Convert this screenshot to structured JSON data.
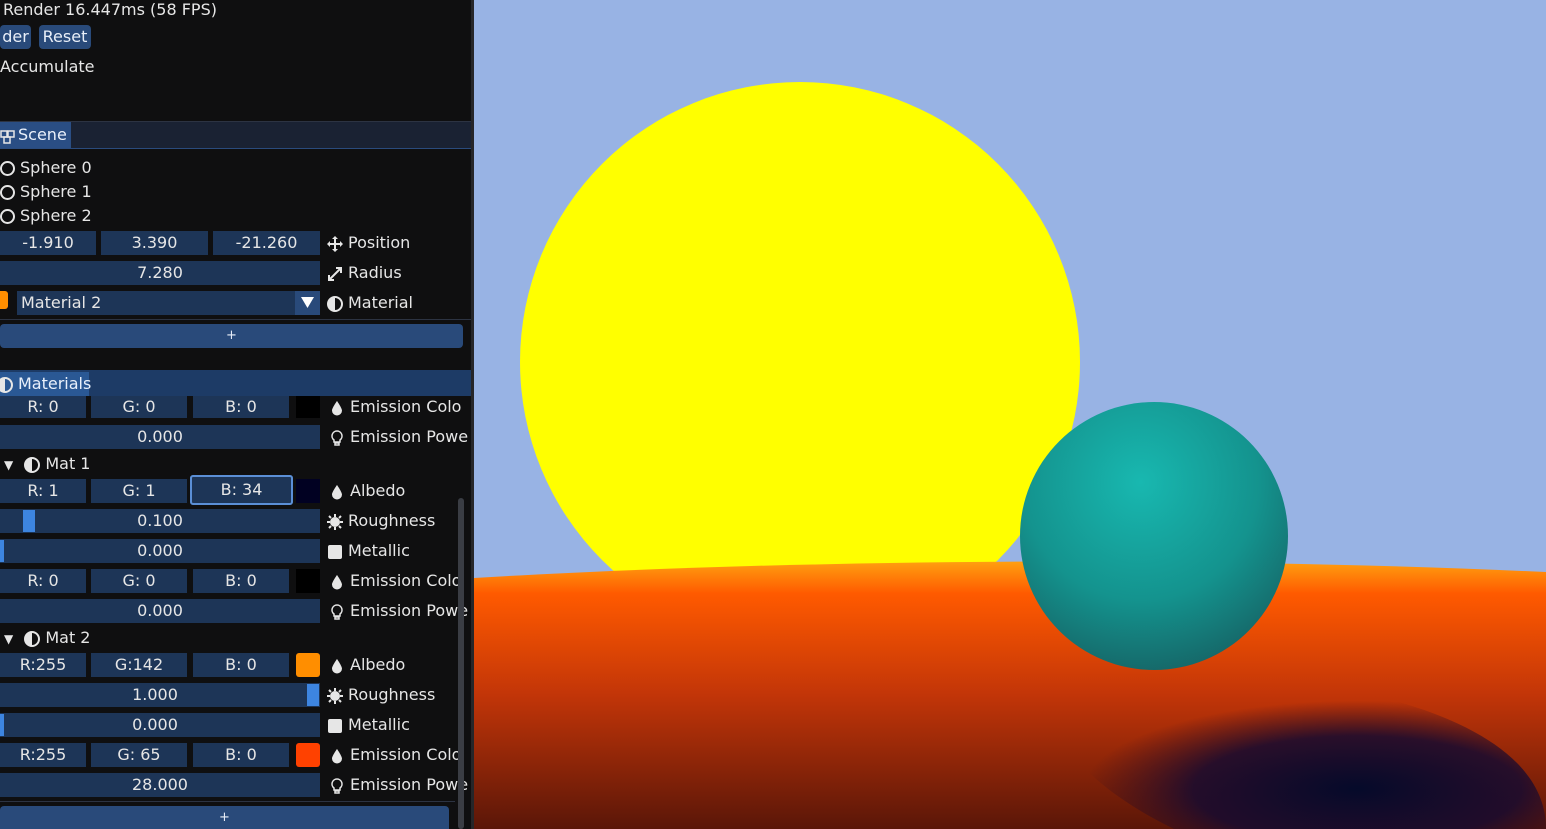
{
  "stats": {
    "render_text": "Render 16.447ms (58 FPS)"
  },
  "controls": {
    "render_button": "der",
    "reset_button": "Reset",
    "accumulate_label": "Accumulate"
  },
  "scene": {
    "tab_label": "Scene",
    "spheres": [
      "Sphere 0",
      "Sphere 1",
      "Sphere 2"
    ],
    "position": {
      "x": "-1.910",
      "y": "3.390",
      "z": "-21.260",
      "label": "Position"
    },
    "radius": {
      "value": "7.280",
      "label": "Radius"
    },
    "material": {
      "value": "Material 2",
      "label": "Material",
      "swatch_color": "#ff8e00"
    },
    "add_button": "+"
  },
  "materials": {
    "tab_label": "Materials",
    "top": {
      "emission_color": {
        "r": "R: 0",
        "g": "G: 0",
        "b": "B: 0",
        "label": "Emission Colo",
        "swatch_color": "#000000"
      },
      "emission_power": {
        "value": "0.000",
        "label": "Emission Powe"
      }
    },
    "mat1": {
      "name": "Mat 1",
      "albedo": {
        "r": "R: 1",
        "g": "G: 1",
        "b": "B: 34",
        "label": "Albedo",
        "swatch_color": "#010122"
      },
      "roughness": {
        "value": "0.100",
        "label": "Roughness",
        "fraction": 0.1
      },
      "metallic": {
        "value": "0.000",
        "label": "Metallic",
        "fraction": 0.0
      },
      "emission_color": {
        "r": "R: 0",
        "g": "G: 0",
        "b": "B: 0",
        "label": "Emission Colo",
        "swatch_color": "#000000"
      },
      "emission_power": {
        "value": "0.000",
        "label": "Emission Powe"
      }
    },
    "mat2": {
      "name": "Mat 2",
      "albedo": {
        "r": "R:255",
        "g": "G:142",
        "b": "B: 0",
        "label": "Albedo",
        "swatch_color": "#ff8e00"
      },
      "roughness": {
        "value": "1.000",
        "label": "Roughness",
        "fraction": 1.0
      },
      "metallic": {
        "value": "0.000",
        "label": "Metallic",
        "fraction": 0.0
      },
      "emission_color": {
        "r": "R:255",
        "g": "G: 65",
        "b": "B: 0",
        "label": "Emission Colo",
        "swatch_color": "#ff4100"
      },
      "emission_power": {
        "value": "28.000",
        "label": "Emission Powe"
      }
    },
    "add_button": "+"
  },
  "colors": {
    "accent": "#294a7a",
    "field": "#1d3557",
    "sky": "#98b3e4",
    "sun": "#ffff00",
    "sphere": "#13a39b"
  }
}
